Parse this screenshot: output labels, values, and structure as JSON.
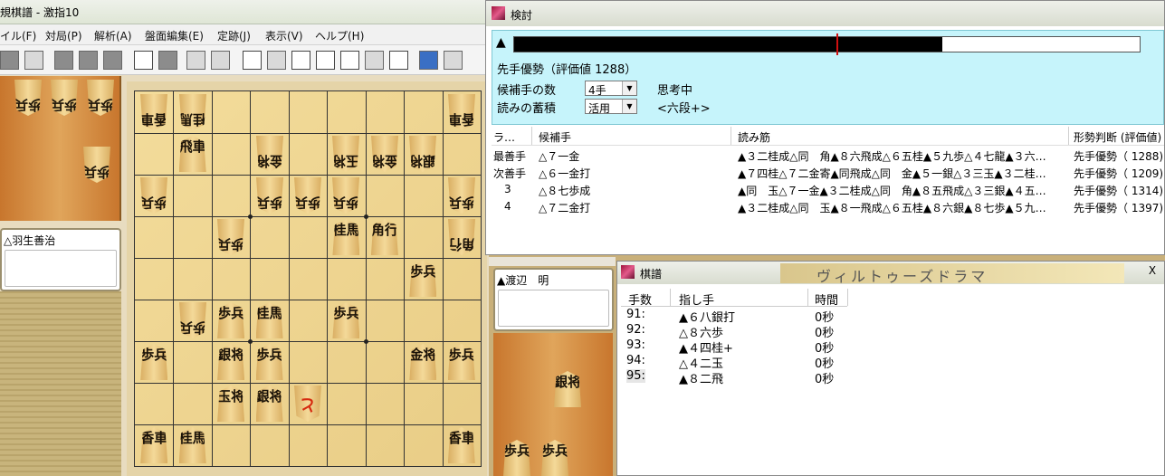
{
  "main": {
    "title": "規棋譜 - 激指10",
    "menu": [
      "イル(F)",
      "対局(P)",
      "解析(A)",
      "盤面編集(E)",
      "定跡(J)",
      "表示(V)",
      "ヘルプ(H)"
    ]
  },
  "players": {
    "gote": "△羽生善治",
    "sente": "▲渡辺　明"
  },
  "board": {
    "pieces": [
      {
        "c": 9,
        "r": 1,
        "t": "香車",
        "side": "gote"
      },
      {
        "c": 8,
        "r": 1,
        "t": "桂馬",
        "side": "gote"
      },
      {
        "c": 1,
        "r": 1,
        "t": "香車",
        "side": "gote"
      },
      {
        "c": 8,
        "r": 2,
        "t": "飛車",
        "side": "sente"
      },
      {
        "c": 6,
        "r": 2,
        "t": "金将",
        "side": "gote"
      },
      {
        "c": 4,
        "r": 2,
        "t": "玉将",
        "side": "gote"
      },
      {
        "c": 3,
        "r": 2,
        "t": "金将",
        "side": "gote"
      },
      {
        "c": 2,
        "r": 2,
        "t": "銀将",
        "side": "gote"
      },
      {
        "c": 9,
        "r": 3,
        "t": "歩兵",
        "side": "gote"
      },
      {
        "c": 6,
        "r": 3,
        "t": "歩兵",
        "side": "gote"
      },
      {
        "c": 5,
        "r": 3,
        "t": "歩兵",
        "side": "gote"
      },
      {
        "c": 4,
        "r": 3,
        "t": "歩兵",
        "side": "gote"
      },
      {
        "c": 1,
        "r": 3,
        "t": "歩兵",
        "side": "gote"
      },
      {
        "c": 7,
        "r": 4,
        "t": "歩兵",
        "side": "gote"
      },
      {
        "c": 4,
        "r": 4,
        "t": "桂馬",
        "side": "sente"
      },
      {
        "c": 3,
        "r": 4,
        "t": "角行",
        "side": "sente"
      },
      {
        "c": 1,
        "r": 4,
        "t": "角行",
        "side": "gote"
      },
      {
        "c": 2,
        "r": 5,
        "t": "歩兵",
        "side": "sente"
      },
      {
        "c": 8,
        "r": 6,
        "t": "歩兵",
        "side": "gote"
      },
      {
        "c": 7,
        "r": 6,
        "t": "歩兵",
        "side": "sente"
      },
      {
        "c": 6,
        "r": 6,
        "t": "桂馬",
        "side": "sente"
      },
      {
        "c": 4,
        "r": 6,
        "t": "歩兵",
        "side": "sente"
      },
      {
        "c": 9,
        "r": 7,
        "t": "歩兵",
        "side": "sente"
      },
      {
        "c": 7,
        "r": 7,
        "t": "銀将",
        "side": "sente"
      },
      {
        "c": 6,
        "r": 7,
        "t": "歩兵",
        "side": "sente"
      },
      {
        "c": 2,
        "r": 7,
        "t": "金将",
        "side": "sente"
      },
      {
        "c": 1,
        "r": 7,
        "t": "歩兵",
        "side": "sente"
      },
      {
        "c": 7,
        "r": 8,
        "t": "玉将",
        "side": "sente"
      },
      {
        "c": 6,
        "r": 8,
        "t": "銀将",
        "side": "sente"
      },
      {
        "c": 5,
        "r": 8,
        "t": "と",
        "side": "gote",
        "red": true
      },
      {
        "c": 9,
        "r": 9,
        "t": "香車",
        "side": "sente"
      },
      {
        "c": 8,
        "r": 9,
        "t": "桂馬",
        "side": "sente"
      },
      {
        "c": 1,
        "r": 9,
        "t": "香車",
        "side": "sente"
      }
    ]
  },
  "hands": {
    "gote": [
      {
        "t": "歩兵"
      },
      {
        "t": "歩兵"
      },
      {
        "t": "歩兵"
      },
      {
        "t": "歩兵"
      }
    ],
    "sente": [
      {
        "t": "銀将"
      },
      {
        "t": "歩兵"
      },
      {
        "t": "歩兵"
      }
    ]
  },
  "kento": {
    "title": "検討",
    "bar_marker": "▲",
    "eval_fraction": 0.685,
    "evaluation": "先手優勢（評価値 1288）",
    "candidates_label": "候補手の数",
    "candidates_value": "4手",
    "accumulate_label": "読みの蓄積",
    "accumulate_value": "活用",
    "status": "思考中",
    "level": "<六段+>",
    "headers": [
      "ラ…",
      "候補手",
      "読み筋",
      "形勢判断 (評価値)"
    ],
    "rows": [
      {
        "rank": "最善手",
        "move": "△７一金",
        "pv": "▲３二桂成△同　角▲８六飛成△６五桂▲５九歩△４七龍▲３六…",
        "judge": "先手優勢（ 1288)"
      },
      {
        "rank": "次善手",
        "move": "△６一金打",
        "pv": "▲７四桂△７二金寄▲同飛成△同　金▲５一銀△３三玉▲３二桂…",
        "judge": "先手優勢（ 1209)"
      },
      {
        "rank": "3",
        "move": "△８七歩成",
        "pv": "▲同　玉△７一金▲３二桂成△同　角▲８五飛成△３三銀▲４五…",
        "judge": "先手優勢（ 1314)"
      },
      {
        "rank": "4",
        "move": "△７二金打",
        "pv": "▲３二桂成△同　玉▲８一飛成△６五桂▲８六銀▲８七歩▲５九…",
        "judge": "先手優勢（ 1397)"
      }
    ]
  },
  "kifu": {
    "title": "棋譜",
    "banner": "ヴィルトゥーズドラマ",
    "close": "X",
    "headers": [
      "手数",
      "指し手",
      "時間"
    ],
    "rows": [
      {
        "n": "91:",
        "move": "▲６八銀打",
        "time": "0秒"
      },
      {
        "n": "92:",
        "move": "△８六歩",
        "time": "0秒"
      },
      {
        "n": "93:",
        "move": "▲４四桂+",
        "time": "0秒"
      },
      {
        "n": "94:",
        "move": "△４二玉",
        "time": "0秒"
      },
      {
        "n": "95:",
        "move": "▲８二飛",
        "time": "0秒"
      }
    ]
  }
}
